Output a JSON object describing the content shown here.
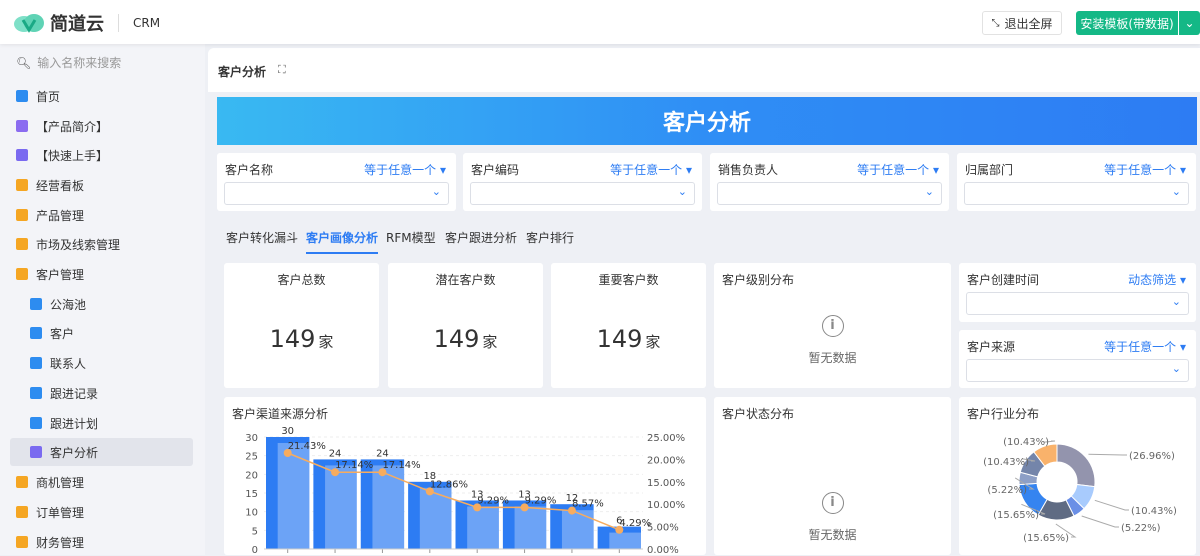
{
  "header": {
    "brand": "简道云",
    "product": "CRM",
    "exit_fullscreen": "退出全屏",
    "install": "安装模板(带数据)"
  },
  "sidebar": {
    "search_placeholder": "输入名称来搜索",
    "items": [
      {
        "label": "首页",
        "color": "#2d8cf0",
        "sub": false
      },
      {
        "label": "【产品简介】",
        "color": "#8b6cf0",
        "sub": false
      },
      {
        "label": "【快速上手】",
        "color": "#7a6af0",
        "sub": false
      },
      {
        "label": "经营看板",
        "color": "#f5a623",
        "sub": false
      },
      {
        "label": "产品管理",
        "color": "#f5a623",
        "sub": false
      },
      {
        "label": "市场及线索管理",
        "color": "#f5a623",
        "sub": false
      },
      {
        "label": "客户管理",
        "color": "#f5a623",
        "sub": false
      },
      {
        "label": "公海池",
        "color": "#2d8cf0",
        "sub": true
      },
      {
        "label": "客户",
        "color": "#2d8cf0",
        "sub": true
      },
      {
        "label": "联系人",
        "color": "#2d8cf0",
        "sub": true
      },
      {
        "label": "跟进记录",
        "color": "#2d8cf0",
        "sub": true
      },
      {
        "label": "跟进计划",
        "color": "#2d8cf0",
        "sub": true
      },
      {
        "label": "客户分析",
        "color": "#7a6af0",
        "sub": true,
        "active": true
      },
      {
        "label": "商机管理",
        "color": "#f5a623",
        "sub": false
      },
      {
        "label": "订单管理",
        "color": "#f5a623",
        "sub": false
      },
      {
        "label": "财务管理",
        "color": "#f5a623",
        "sub": false
      }
    ]
  },
  "main": {
    "title": "客户分析",
    "banner": "客户分析",
    "filters": [
      {
        "label": "客户名称",
        "op": "等于任意一个"
      },
      {
        "label": "客户编码",
        "op": "等于任意一个"
      },
      {
        "label": "销售负责人",
        "op": "等于任意一个"
      },
      {
        "label": "归属部门",
        "op": "等于任意一个"
      }
    ],
    "tabs": [
      "客户转化漏斗",
      "客户画像分析",
      "RFM模型",
      "客户跟进分析",
      "客户排行"
    ],
    "kpis": [
      {
        "title": "客户总数",
        "value": "149",
        "unit": "家"
      },
      {
        "title": "潜在客户数",
        "value": "149",
        "unit": "家"
      },
      {
        "title": "重要客户数",
        "value": "149",
        "unit": "家"
      }
    ],
    "level_title": "客户级别分布",
    "status_title": "客户状态分布",
    "empty": "暂无数据",
    "created": {
      "label": "客户创建时间",
      "op": "动态筛选"
    },
    "source": {
      "label": "客户来源",
      "op": "等于任意一个"
    },
    "channel_title": "客户渠道来源分析",
    "industry_title": "客户行业分布"
  },
  "chart_data": [
    {
      "type": "bar",
      "title": "客户渠道来源分析",
      "values": [
        30,
        24,
        24,
        18,
        13,
        13,
        12,
        6
      ],
      "line_values": [
        21.43,
        17.14,
        17.14,
        12.86,
        9.29,
        9.29,
        8.57,
        4.29
      ],
      "line_labels": [
        "21.43%",
        "17.14%",
        "17.14%",
        "12.86%",
        "9.29%",
        "9.29%",
        "8.57%",
        "4.29%"
      ],
      "ylim": [
        0,
        30
      ],
      "yticks": [
        "0",
        "5",
        "10",
        "15",
        "20",
        "25",
        "30"
      ],
      "y2lim": [
        0,
        25
      ],
      "y2ticks": [
        "0.00%",
        "5.00%",
        "10.00%",
        "15.00%",
        "20.00%",
        "25.00%"
      ],
      "bar_color": "#2d7cf3",
      "line_color": "#f7ac5f"
    },
    {
      "type": "pie",
      "title": "客户行业分布",
      "values": [
        26.96,
        10.43,
        5.22,
        15.65,
        15.65,
        5.22,
        10.43,
        10.43
      ],
      "labels": [
        "(26.96%)",
        "(10.43%)",
        "(5.22%)",
        "(15.65%)",
        "(15.65%)",
        "(5.22%)",
        "(10.43%)",
        "(10.43%)"
      ],
      "colors": [
        "#9394ad",
        "#a8cbfd",
        "#6a8fe6",
        "#5f6b83",
        "#3584f0",
        "#8d9fc6",
        "#7485aa",
        "#f9b26b"
      ]
    }
  ]
}
